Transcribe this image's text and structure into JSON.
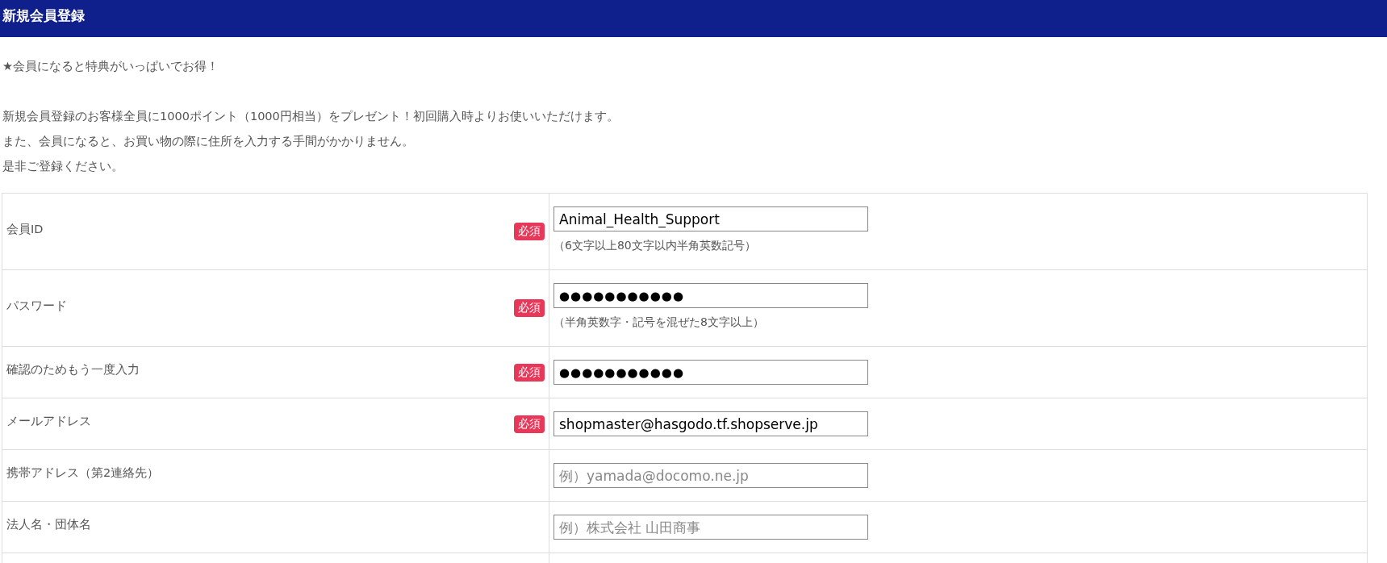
{
  "header": {
    "title": "新規会員登録"
  },
  "intro": {
    "lead": "★会員になると特典がいっぱいでお得！",
    "lines": [
      "新規会員登録のお客様全員に1000ポイント（1000円相当）をプレゼント！初回購入時よりお使いいただけます。",
      "また、会員になると、お買い物の際に住所を入力する手間がかかりません。",
      "是非ご登録ください。"
    ]
  },
  "rows": [
    {
      "kind": "text",
      "label": "会員ID",
      "required": true,
      "badge": "必須",
      "value": "Animal_Health_Support",
      "hint": "（6文字以上80文字以内半角英数記号）"
    },
    {
      "kind": "password",
      "label": "パスワード",
      "required": true,
      "badge": "必須",
      "value": "●●●●●●●●●●●",
      "hint": "（半角英数字・記号を混ぜた8文字以上）"
    },
    {
      "kind": "password",
      "label": "確認のためもう一度入力",
      "required": true,
      "badge": "必須",
      "value": "●●●●●●●●●●●"
    },
    {
      "kind": "text",
      "label": "メールアドレス",
      "required": true,
      "badge": "必須",
      "value": "shopmaster@hasgodo.tf.shopserve.jp"
    },
    {
      "kind": "text",
      "label": "携帯アドレス（第2連絡先）",
      "required": false,
      "placeholder": "例）yamada@docomo.ne.jp"
    },
    {
      "kind": "text",
      "label": "法人名・団体名",
      "required": false,
      "placeholder": "例）株式会社 山田商事"
    },
    {
      "kind": "cut"
    }
  ]
}
